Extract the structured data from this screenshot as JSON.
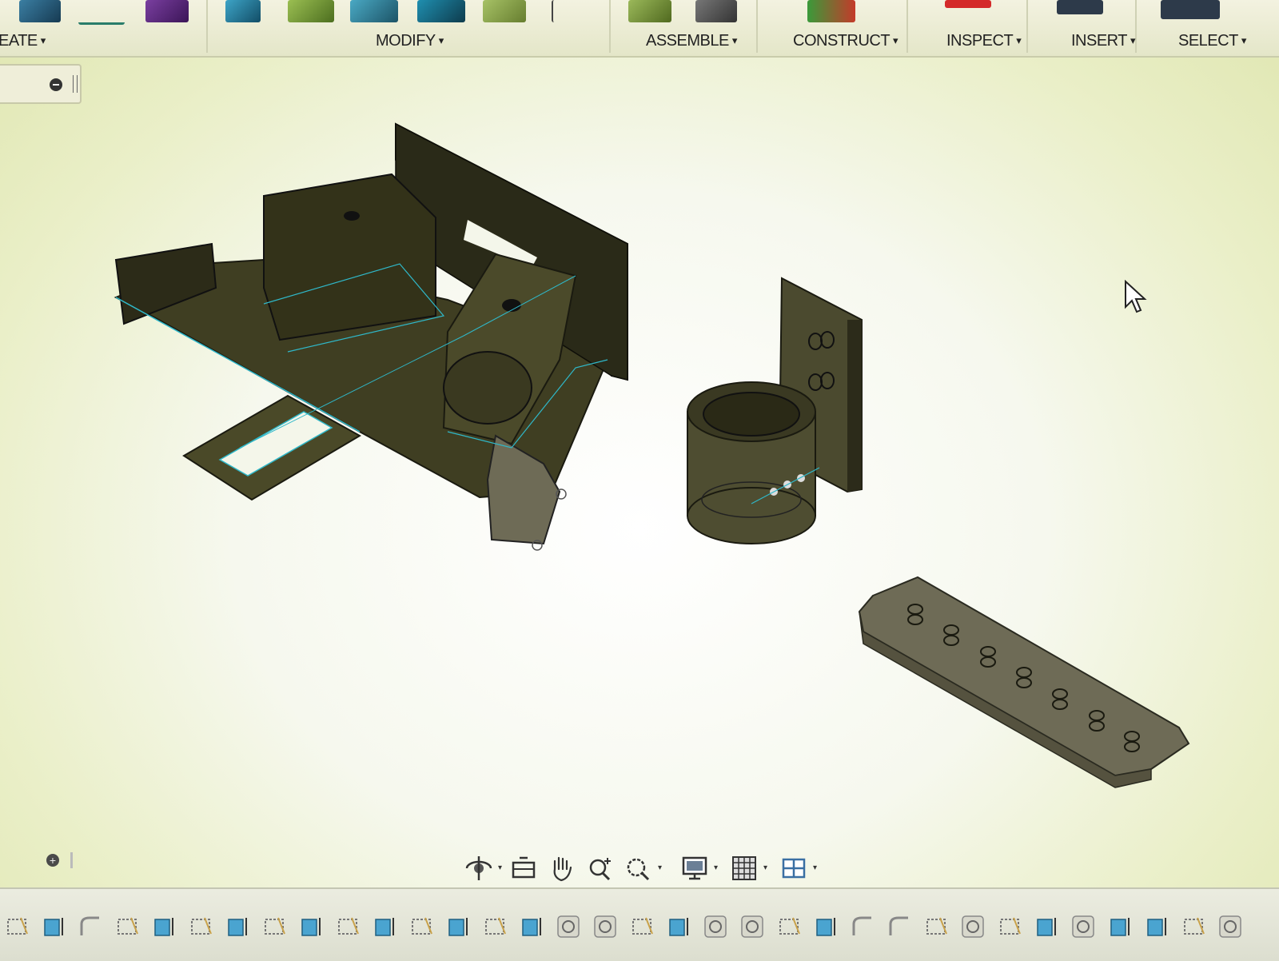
{
  "toolbar": {
    "groups": {
      "create": "EATE",
      "modify": "MODIFY",
      "assemble": "ASSEMBLE",
      "construct": "CONSTRUCT",
      "inspect": "INSPECT",
      "insert": "INSERT",
      "select": "SELECT"
    },
    "caret": "▾"
  },
  "canvas": {
    "bodies": [
      "bracket-assembly",
      "cylinder-cup-with-plate",
      "perforated-strip"
    ]
  },
  "navigation_bar": {
    "buttons": [
      "orbit-icon",
      "look-at-icon",
      "pan-icon",
      "zoom-icon",
      "fit-icon",
      "display-settings-icon",
      "grid-settings-icon",
      "viewports-icon"
    ]
  },
  "timeline": {
    "item_count": 34
  },
  "colors": {
    "model_body": "#3f3e22",
    "model_edge": "#1a1a10",
    "highlight_edge": "#2fb8c9",
    "part_gray": "#6e6b56"
  }
}
